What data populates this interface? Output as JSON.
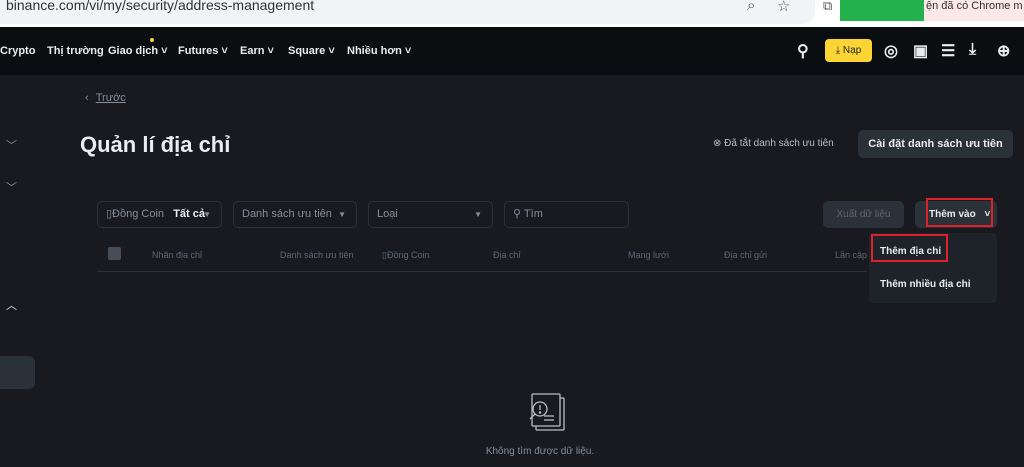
{
  "browser": {
    "url": "binance.com/vi/my/security/address-management",
    "extension_text": "ện đã có Chrome m",
    "icons": [
      "zoom-icon",
      "star-icon",
      "extension-icon"
    ]
  },
  "nav": {
    "items": [
      "Crypto",
      "Thị trường",
      "Giao dịch",
      "Futures",
      "Earn",
      "Square",
      "Nhiều hơn"
    ],
    "deposit_label": "Nạp",
    "accent": "#fcd535",
    "icons": [
      "search-icon",
      "user-icon",
      "wallet-icon",
      "message-icon",
      "download-icon",
      "globe-icon"
    ]
  },
  "back_label": "Trước",
  "page_title": "Quản lí địa chỉ",
  "whitelist_status": "Đã tắt danh sách ưu tiên",
  "whitelist_settings_button": "Cài đặt danh sách ưu tiên",
  "filters": {
    "coin_label": "▯Đồng Coin",
    "coin_value": "Tất cả",
    "whitelist_placeholder": "Danh sách ưu tiên",
    "type_placeholder": "Loại",
    "search_placeholder": "Tìm"
  },
  "export_button": "Xuất dữ liệu",
  "add_button": "Thêm vào",
  "add_menu": [
    "Thêm địa chỉ",
    "Thêm nhiều địa chỉ"
  ],
  "table": {
    "columns": [
      "Nhãn địa chỉ",
      "Danh sách ưu tiên",
      "▯Đồng Coin",
      "Địa chỉ",
      "Mạng lưới",
      "Địa chỉ gửi",
      "Lần cập n"
    ]
  },
  "empty_text": "Không tìm được dữ liệu."
}
